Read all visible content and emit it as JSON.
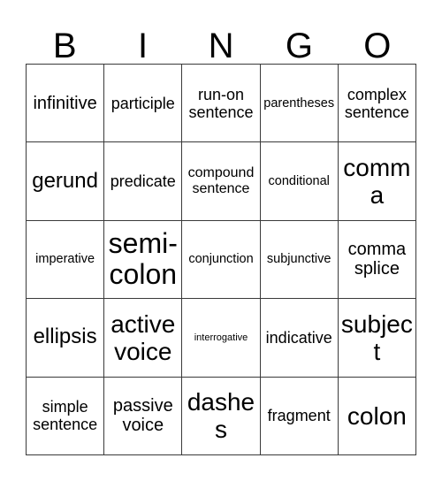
{
  "card": {
    "title": "BINGO",
    "header_letters": [
      "B",
      "I",
      "N",
      "G",
      "O"
    ],
    "grid_size": "5x5",
    "colors": {
      "border": "#3a3a3a",
      "text": "#000000",
      "background": "#ffffff"
    },
    "cells": [
      {
        "text": "infinitive",
        "size": "l"
      },
      {
        "text": "participle",
        "size": "m"
      },
      {
        "text": "run-on sentence",
        "size": "m"
      },
      {
        "text": "parentheses",
        "size": "xs"
      },
      {
        "text": "complex sentence",
        "size": "m"
      },
      {
        "text": "gerund",
        "size": "xl"
      },
      {
        "text": "predicate",
        "size": "m"
      },
      {
        "text": "compound sentence",
        "size": "s"
      },
      {
        "text": "conditional",
        "size": "xs"
      },
      {
        "text": "comma",
        "size": "xxl"
      },
      {
        "text": "imperative",
        "size": "xs"
      },
      {
        "text": "semi-colon",
        "size": "huge"
      },
      {
        "text": "conjunction",
        "size": "xs"
      },
      {
        "text": "subjunctive",
        "size": "xs"
      },
      {
        "text": "comma splice",
        "size": "l"
      },
      {
        "text": "ellipsis",
        "size": "xl"
      },
      {
        "text": "active voice",
        "size": "xxl"
      },
      {
        "text": "interrogative",
        "size": "xxs"
      },
      {
        "text": "indicative",
        "size": "m"
      },
      {
        "text": "subject",
        "size": "xxl"
      },
      {
        "text": "simple sentence",
        "size": "m"
      },
      {
        "text": "passive voice",
        "size": "l"
      },
      {
        "text": "dashes",
        "size": "xxl"
      },
      {
        "text": "fragment",
        "size": "m"
      },
      {
        "text": "colon",
        "size": "xxl"
      }
    ]
  }
}
